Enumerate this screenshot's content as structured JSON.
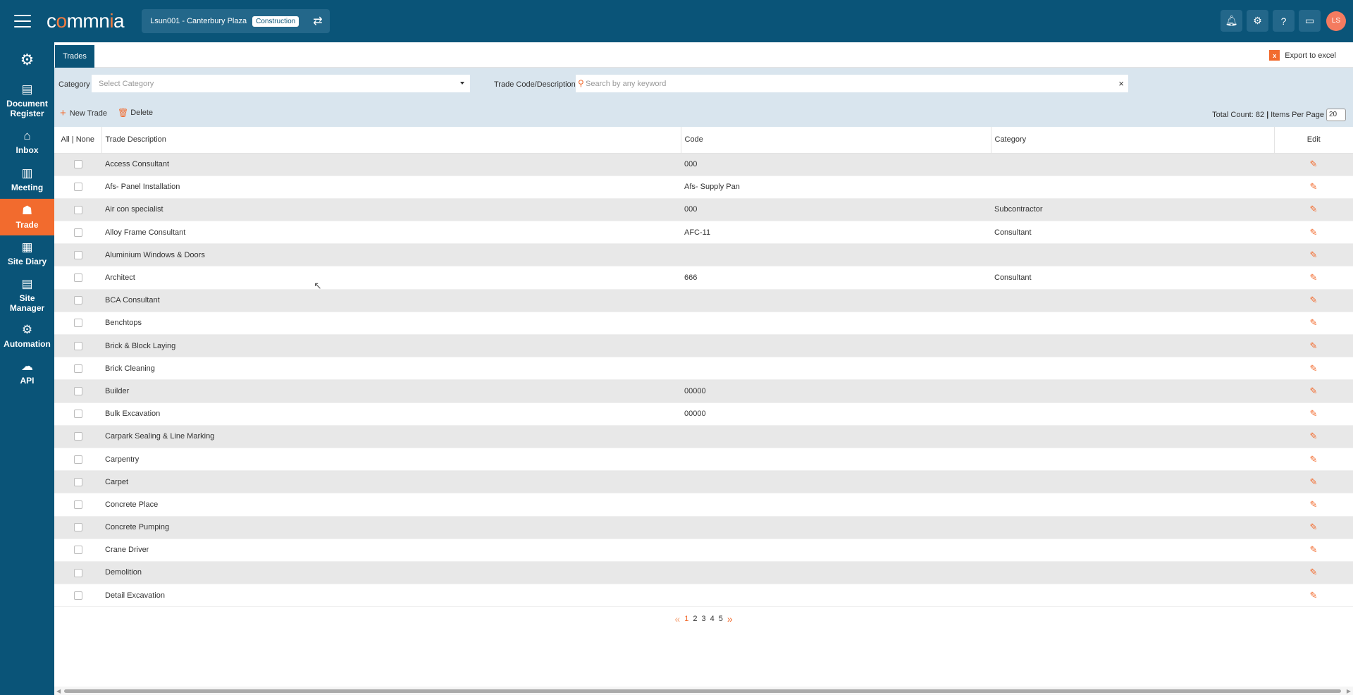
{
  "header": {
    "logo_pre": "c",
    "logo_o": "o",
    "logo_mid": "mmn",
    "logo_i": "i",
    "logo_post": "a",
    "project": "Lsun001 - Canterbury Plaza",
    "badge": "Construction",
    "avatar_initials": "LS",
    "icons": [
      "bell-icon",
      "settings-icon",
      "help-icon",
      "chat-icon"
    ]
  },
  "sidebar": {
    "items": [
      {
        "label1": "Document",
        "label2": "Register",
        "icon": "document-icon"
      },
      {
        "label1": "Inbox",
        "label2": "",
        "icon": "inbox-icon"
      },
      {
        "label1": "Meeting",
        "label2": "",
        "icon": "meeting-icon"
      },
      {
        "label1": "Trade",
        "label2": "",
        "icon": "trade-icon"
      },
      {
        "label1": "Site Diary",
        "label2": "",
        "icon": "calendar-icon"
      },
      {
        "label1": "Site",
        "label2": "Manager",
        "icon": "clipboard-icon"
      },
      {
        "label1": "Automation",
        "label2": "",
        "icon": "gear-icon"
      },
      {
        "label1": "API",
        "label2": "",
        "icon": "cloud-icon"
      }
    ]
  },
  "tabs": {
    "trades": "Trades"
  },
  "export_label": "Export to excel",
  "filters": {
    "category_label": "Category",
    "category_placeholder": "Select Category",
    "trade_label": "Trade Code/Description",
    "search_placeholder": "Search by any keyword"
  },
  "actions": {
    "new_trade": "New Trade",
    "delete": "Delete",
    "total_count": "Total Count: 82",
    "items_per_page": "Items Per Page",
    "per_page_value": "20"
  },
  "table": {
    "headers": {
      "select": "All | None",
      "description": "Trade Description",
      "code": "Code",
      "category": "Category",
      "edit": "Edit"
    },
    "rows": [
      {
        "description": "Access Consultant",
        "code": "000",
        "category": ""
      },
      {
        "description": "Afs- Panel Installation",
        "code": "Afs- Supply Pan",
        "category": ""
      },
      {
        "description": "Air con specialist",
        "code": "000",
        "category": "Subcontractor"
      },
      {
        "description": "Alloy Frame Consultant",
        "code": "AFC-11",
        "category": "Consultant"
      },
      {
        "description": "Aluminium Windows & Doors",
        "code": "",
        "category": ""
      },
      {
        "description": "Architect",
        "code": "666",
        "category": "Consultant"
      },
      {
        "description": "BCA Consultant",
        "code": "",
        "category": ""
      },
      {
        "description": "Benchtops",
        "code": "",
        "category": ""
      },
      {
        "description": "Brick & Block Laying",
        "code": "",
        "category": ""
      },
      {
        "description": "Brick Cleaning",
        "code": "",
        "category": ""
      },
      {
        "description": "Builder",
        "code": "00000",
        "category": ""
      },
      {
        "description": "Bulk Excavation",
        "code": "00000",
        "category": ""
      },
      {
        "description": "Carpark Sealing & Line Marking",
        "code": "",
        "category": ""
      },
      {
        "description": "Carpentry",
        "code": "",
        "category": ""
      },
      {
        "description": "Carpet",
        "code": "",
        "category": ""
      },
      {
        "description": "Concrete Place",
        "code": "",
        "category": ""
      },
      {
        "description": "Concrete Pumping",
        "code": "",
        "category": ""
      },
      {
        "description": "Crane Driver",
        "code": "",
        "category": ""
      },
      {
        "description": "Demolition",
        "code": "",
        "category": ""
      },
      {
        "description": "Detail Excavation",
        "code": "",
        "category": ""
      }
    ]
  },
  "pagination": {
    "first": "«",
    "pages": [
      "1",
      "2",
      "3",
      "4",
      "5"
    ],
    "last": "»",
    "current": "1"
  },
  "colors": {
    "primary": "#0a5478",
    "accent": "#f26b2e",
    "filter_bg": "#d9e5ee"
  }
}
